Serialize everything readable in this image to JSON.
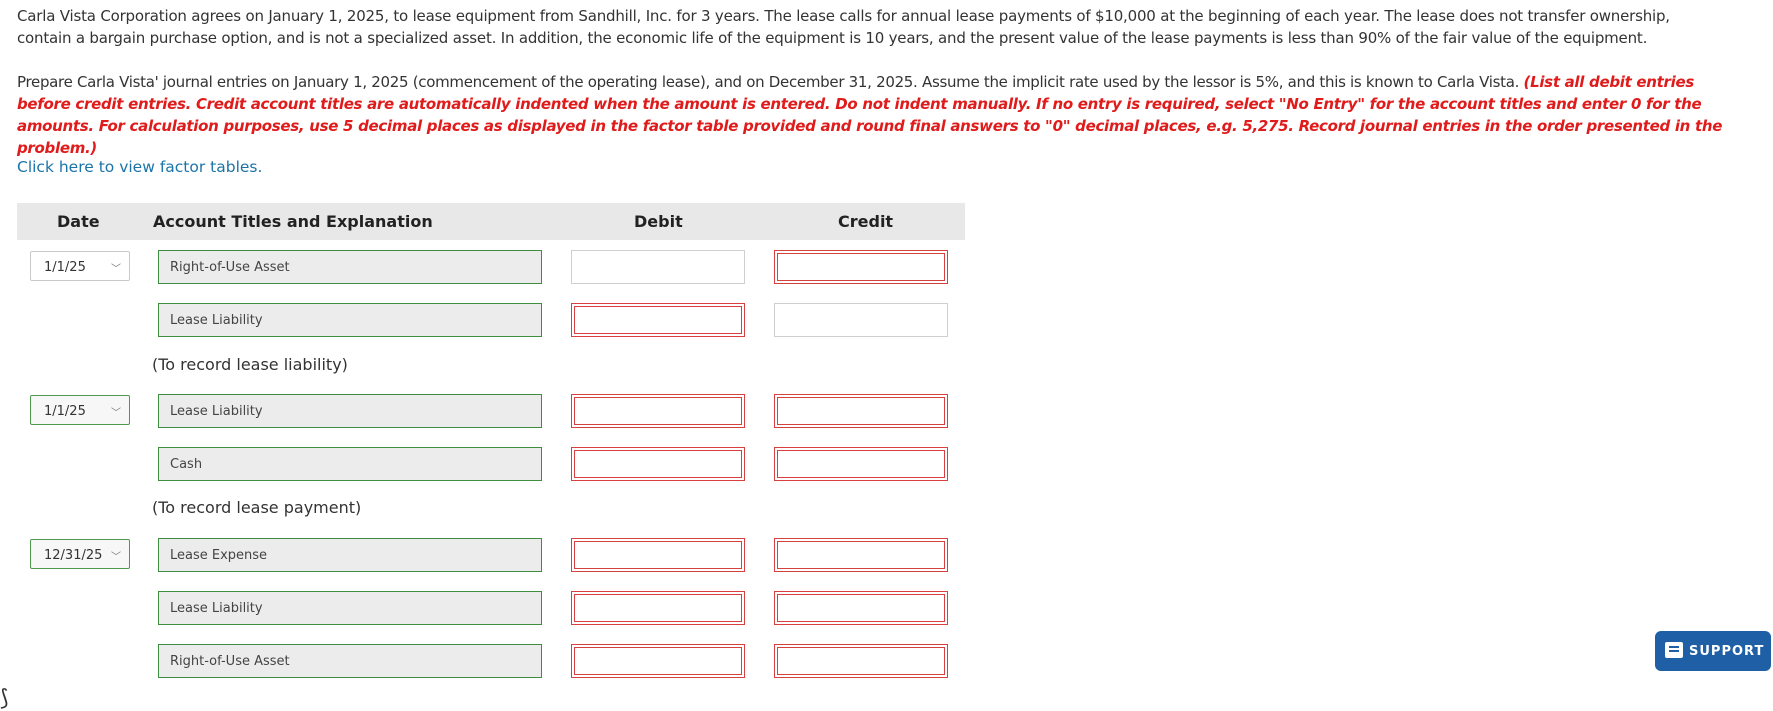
{
  "question": {
    "paragraph1": "Carla Vista Corporation agrees on January 1, 2025, to lease equipment from Sandhill, Inc. for 3 years. The lease calls for annual lease payments of $10,000 at the beginning of each year. The lease does not transfer ownership, contain a bargain purchase option, and is not a specialized asset. In addition, the economic life of the equipment is 10 years, and the present value of the lease payments is less than 90% of the fair value of the equipment.",
    "paragraph2_plain": "Prepare Carla Vista' journal entries on January 1, 2025 (commencement of the operating lease), and on December 31, 2025. Assume the implicit rate used by the lessor is 5%, and this is known to Carla Vista. ",
    "paragraph2_red": "(List all debit entries before credit entries. Credit account titles are automatically indented when the amount is entered. Do not indent manually. If no entry is required, select \"No Entry\" for the account titles and enter 0 for the amounts. For calculation purposes, use 5 decimal places as displayed in the factor table provided and round final answers to \"0\" decimal places, e.g. 5,275. Record journal entries in the order presented in the problem.)",
    "factor_link": "Click here to view factor tables."
  },
  "table": {
    "headers": {
      "date": "Date",
      "account": "Account Titles and Explanation",
      "debit": "Debit",
      "credit": "Credit"
    },
    "rows": [
      {
        "date": "1/1/25",
        "account": "Right-of-Use Asset"
      },
      {
        "account": "Lease Liability"
      },
      {
        "date": "1/1/25",
        "account": "Lease Liability"
      },
      {
        "account": "Cash"
      },
      {
        "date": "12/31/25",
        "account": "Lease Expense"
      },
      {
        "account": "Lease Liability"
      },
      {
        "account": "Right-of-Use Asset"
      }
    ],
    "notes": [
      "(To record lease liability)",
      "(To record lease payment)"
    ]
  },
  "support": {
    "label": "SUPPORT",
    "icon": "chat-icon",
    "color": "#1e5fa6"
  },
  "colors": {
    "error_border": "#d84040",
    "valid_border": "#3f8e3f",
    "link": "#1b74a8",
    "instruction": "#e01b1b"
  }
}
